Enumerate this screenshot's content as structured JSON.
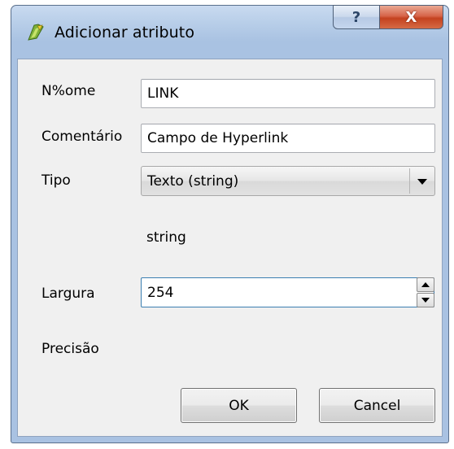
{
  "window": {
    "title": "Adicionar atributo",
    "app_icon": "qgis-icon",
    "help_glyph": "?",
    "close_glyph": "X"
  },
  "form": {
    "name_label": "N%ome",
    "name_value": "LINK",
    "comment_label": "Comentário",
    "comment_value": "Campo de Hyperlink",
    "type_label": "Tipo",
    "type_value": "Texto (string)",
    "type_name_text": "string",
    "width_label": "Largura",
    "width_value": "254",
    "precision_label": "Precisão"
  },
  "buttons": {
    "ok_label": "OK",
    "cancel_label": "Cancel"
  },
  "colors": {
    "titlebar": "#b9cfe9",
    "close_button": "#c4421f",
    "focus_border": "#3c7fb1",
    "client_background": "#f0f0f0"
  }
}
